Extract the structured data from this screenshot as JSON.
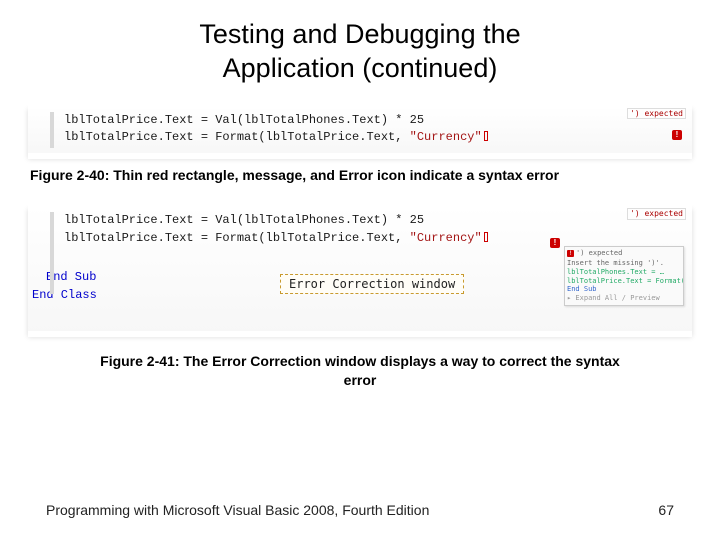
{
  "title_line1": "Testing and Debugging the",
  "title_line2": "Application (continued)",
  "figure1": {
    "code_line1_a": "lblTotalPrice.Text = Val(lblTotalPhones.Text) * 25",
    "code_line2_a": "lblTotalPrice.Text = Format(lblTotalPrice.Text, ",
    "code_line2_str": "\"Currency\"",
    "tag": "') expected",
    "caption": "Figure 2-40: Thin red rectangle, message, and Error icon indicate a syntax error"
  },
  "figure2": {
    "code_line1_a": "lblTotalPrice.Text = Val(lblTotalPhones.Text) * 25",
    "code_line2_a": "lblTotalPrice.Text = Format(lblTotalPrice.Text, ",
    "code_line2_str": "\"Currency\"",
    "end_sub": "End Sub",
    "end_class": "End Class",
    "correction_label": "Error Correction window",
    "panel_head": "') expected",
    "panel_line1": "Insert the missing ')'.",
    "panel_line2": "lblTotalPhones.Text = …",
    "panel_line3": "lblTotalPrice.Text = Format(…",
    "panel_end_sub": "End Sub",
    "panel_expand": "▸ Expand All / Preview",
    "caption": "Figure 2-41: The Error Correction window displays a way to correct the syntax error"
  },
  "footer": {
    "book": "Programming with Microsoft Visual Basic 2008, Fourth Edition",
    "page": "67"
  }
}
